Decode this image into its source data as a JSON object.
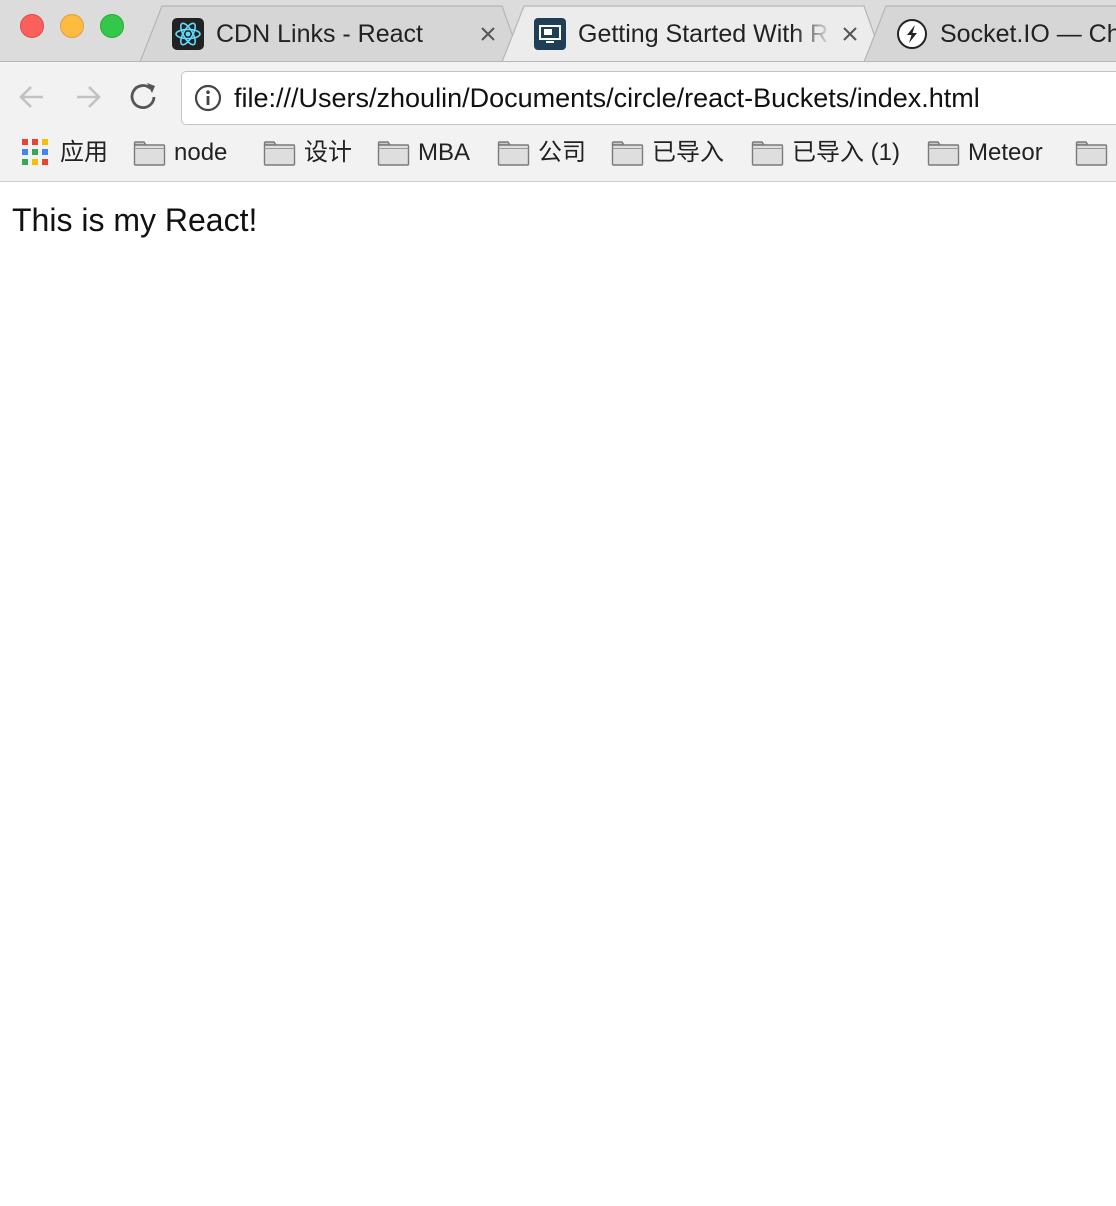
{
  "window": {
    "traffic_lights": {
      "close": "#fc605b",
      "minimize": "#fdbc40",
      "zoom": "#34c84a"
    }
  },
  "tabs": [
    {
      "title": "CDN Links - React",
      "favicon": "react-logo-icon",
      "active": false,
      "close": "×"
    },
    {
      "title": "Getting Started With R",
      "favicon": "monitor-icon",
      "active": true,
      "close": "×"
    },
    {
      "title": "Socket.IO — Ch",
      "favicon": "socketio-icon",
      "active": false
    }
  ],
  "toolbar": {
    "url": "file:///Users/zhoulin/Documents/circle/react-Buckets/index.html",
    "back_icon": "back-arrow-icon",
    "forward_icon": "forward-arrow-icon",
    "reload_icon": "reload-icon",
    "info_icon": "info-icon"
  },
  "bookmarks": {
    "apps_label": "应用",
    "items": [
      {
        "label": "node",
        "icon": "folder-icon"
      },
      {
        "label": "设计",
        "icon": "folder-icon"
      },
      {
        "label": "MBA",
        "icon": "folder-icon"
      },
      {
        "label": "公司",
        "icon": "folder-icon"
      },
      {
        "label": "已导入",
        "icon": "folder-icon"
      },
      {
        "label": "已导入 (1)",
        "icon": "folder-icon"
      },
      {
        "label": "Meteor",
        "icon": "folder-icon"
      }
    ]
  },
  "page": {
    "message": "This is my React!"
  },
  "colors": {
    "tab_strip": "#dcdcdc",
    "toolbar": "#f2f2f2",
    "react_blue": "#61dafb",
    "react_favicon_bg": "#222222",
    "monitor_favicon_bg": "#1f3f56"
  }
}
